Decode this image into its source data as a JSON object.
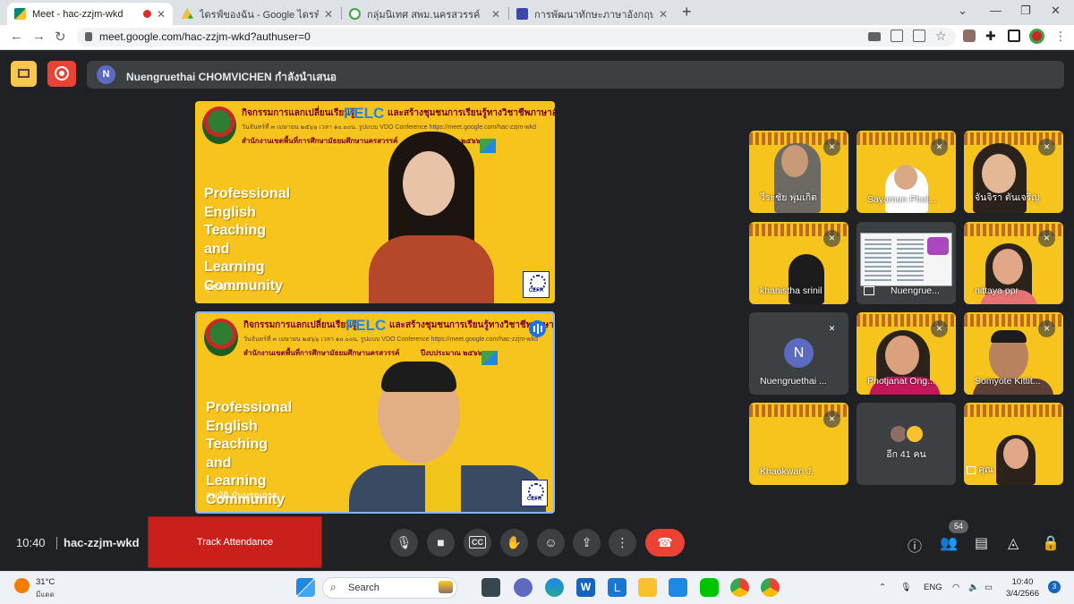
{
  "browser": {
    "tabs": [
      {
        "label": "Meet - hac-zzjm-wkd",
        "active": true,
        "recording": true
      },
      {
        "label": "ไดรฟ์ของฉัน - Google ไดรฟ์",
        "active": false
      },
      {
        "label": "กลุ่มนิเทศ สพม.นครสวรรค์",
        "active": false
      },
      {
        "label": "การพัฒนาทักษะภาษาอังกฤษ English",
        "active": false
      }
    ],
    "url": "meet.google.com/hac-zzjm-wkd?authuser=0"
  },
  "meet": {
    "presenter": {
      "avatar_letter": "N",
      "text": "Nuengruethai CHOMVICHEN กำลังนำเสนอ"
    },
    "slide": {
      "line1": "กิจกรรมการแลกเปลี่ยนเรียนรู้",
      "pelc": "PELC",
      "line1b": "และสร้างชุมชนการเรียนรู้ทางวิชาชีพภาษาอังกฤษ",
      "line2": "วันจันทร์ที่ ๓ เมษายน ๒๕๖๖ เวลา ๑๐.๐๐น. รูปแบบ VDO Conference https://meet.google.com/hac-zzjm-wkd",
      "line3": "สำนักงานเขตพื้นที่การศึกษามัธยมศึกษานครสวรรค์",
      "year": "ปีงบประมาณ ๒๕๖๖",
      "big": [
        "Professional",
        "English",
        "Teaching",
        "and",
        "Learning",
        "Community"
      ],
      "cefr": "CEFR"
    },
    "main_tiles": [
      {
        "caption": "สุชาดา..."
      },
      {
        "caption": "สมบัติ มั่นบูรณการ"
      }
    ],
    "participants": [
      {
        "name": "วีระชัย พุ่มเกิด"
      },
      {
        "name": "Sayamon Phol..."
      },
      {
        "name": "จันจิรา ตันเจริญ"
      },
      {
        "name": "khanistha srinil"
      },
      {
        "name": "Nuengrue..."
      },
      {
        "name": "nittaya ppr"
      },
      {
        "name": "Nuengruethai ...",
        "avatar_letter": "N"
      },
      {
        "name": "Photjanat Ong..."
      },
      {
        "name": "Somyote Kittit..."
      },
      {
        "name": "Khaokwan J."
      },
      {
        "name": "อีก 41 คน"
      },
      {
        "name": "คุณ"
      }
    ],
    "time": "10:40",
    "meeting_code": "hac-zzjm-wkd",
    "track_attendance": "Track Attendance",
    "participant_count": "54"
  },
  "taskbar": {
    "weather_temp": "31°C",
    "weather_desc": "มีแดด",
    "search": "Search",
    "lang": "ENG",
    "clock_time": "10:40",
    "clock_date": "3/4/2566",
    "notifications": "3"
  }
}
